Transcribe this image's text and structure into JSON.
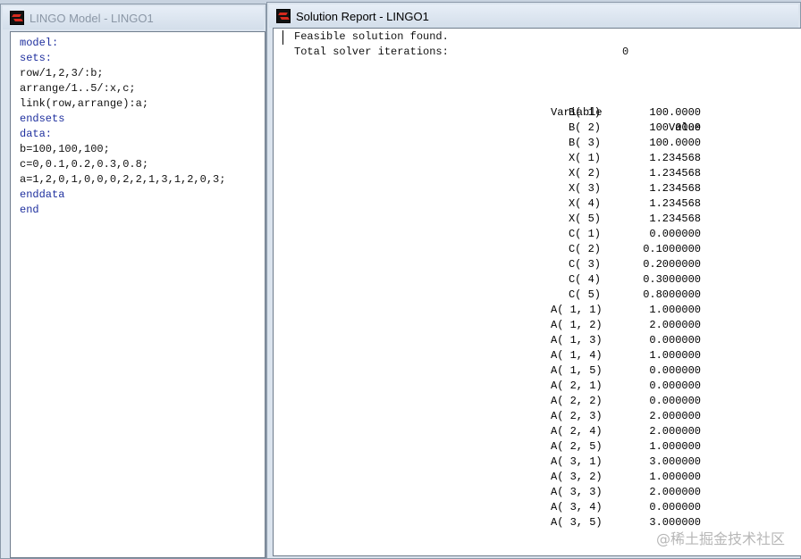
{
  "model_window": {
    "title": "LINGO Model - LINGO1",
    "lines": [
      {
        "text": "model:",
        "kind": "kw"
      },
      {
        "text": "sets:",
        "kind": "kw"
      },
      {
        "text": "row/1,2,3/:b;",
        "kind": "plain"
      },
      {
        "text": "arrange/1..5/:x,c;",
        "kind": "plain"
      },
      {
        "text": "link(row,arrange):a;",
        "kind": "plain"
      },
      {
        "text": "endsets",
        "kind": "kw"
      },
      {
        "text": "data:",
        "kind": "kw"
      },
      {
        "text": "b=100,100,100;",
        "kind": "plain"
      },
      {
        "text": "c=0,0.1,0.2,0.3,0.8;",
        "kind": "plain"
      },
      {
        "text": "a=1,2,0,1,0,0,0,2,2,1,3,1,2,0,3;",
        "kind": "plain"
      },
      {
        "text": "enddata",
        "kind": "kw"
      },
      {
        "text": "end",
        "kind": "kw"
      }
    ]
  },
  "report_window": {
    "title": "Solution Report - LINGO1",
    "feasible_text": "Feasible solution found.",
    "iterations_label": "Total solver iterations:",
    "iterations_value": "0",
    "header_variable": "Variable",
    "header_value": "Value",
    "rows": [
      {
        "variable": "B( 1)",
        "value": "100.0000"
      },
      {
        "variable": "B( 2)",
        "value": "100.0000"
      },
      {
        "variable": "B( 3)",
        "value": "100.0000"
      },
      {
        "variable": "X( 1)",
        "value": "1.234568"
      },
      {
        "variable": "X( 2)",
        "value": "1.234568"
      },
      {
        "variable": "X( 3)",
        "value": "1.234568"
      },
      {
        "variable": "X( 4)",
        "value": "1.234568"
      },
      {
        "variable": "X( 5)",
        "value": "1.234568"
      },
      {
        "variable": "C( 1)",
        "value": "0.000000"
      },
      {
        "variable": "C( 2)",
        "value": "0.1000000"
      },
      {
        "variable": "C( 3)",
        "value": "0.2000000"
      },
      {
        "variable": "C( 4)",
        "value": "0.3000000"
      },
      {
        "variable": "C( 5)",
        "value": "0.8000000"
      },
      {
        "variable": "A( 1, 1)",
        "value": "1.000000"
      },
      {
        "variable": "A( 1, 2)",
        "value": "2.000000"
      },
      {
        "variable": "A( 1, 3)",
        "value": "0.000000"
      },
      {
        "variable": "A( 1, 4)",
        "value": "1.000000"
      },
      {
        "variable": "A( 1, 5)",
        "value": "0.000000"
      },
      {
        "variable": "A( 2, 1)",
        "value": "0.000000"
      },
      {
        "variable": "A( 2, 2)",
        "value": "0.000000"
      },
      {
        "variable": "A( 2, 3)",
        "value": "2.000000"
      },
      {
        "variable": "A( 2, 4)",
        "value": "2.000000"
      },
      {
        "variable": "A( 2, 5)",
        "value": "1.000000"
      },
      {
        "variable": "A( 3, 1)",
        "value": "3.000000"
      },
      {
        "variable": "A( 3, 2)",
        "value": "1.000000"
      },
      {
        "variable": "A( 3, 3)",
        "value": "2.000000"
      },
      {
        "variable": "A( 3, 4)",
        "value": "0.000000"
      },
      {
        "variable": "A( 3, 5)",
        "value": "3.000000"
      }
    ]
  },
  "watermark": "@稀土掘金技术社区",
  "icon": "lingo-app-icon"
}
